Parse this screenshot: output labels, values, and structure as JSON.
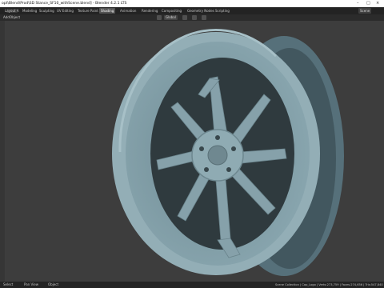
{
  "window": {
    "title": "[C:\\Users\\...\\Desktop\\Wheel Mod\\Blend\\Prod\\SD Stance_SF10_withScene.blend] - Blender 4.2.1 LTS",
    "title_visible": "opt\\Blend\\Prod\\SD Stance_SF10_withScene.blend] - Blender 4.2.1 LTS",
    "min_glyph": "–",
    "max_glyph": "□",
    "close_glyph": "×"
  },
  "menubar": {
    "tabs": [
      "Layout",
      "Modeling",
      "Sculpting",
      "UV Editing",
      "Texture Paint",
      "Shading",
      "Animation",
      "Rendering",
      "Compositing",
      "Geometry Nodes",
      "Scripting"
    ],
    "tabs_visible": [
      "Layout A",
      "Modeling",
      "Sculpting",
      "UV Editing",
      "Texture Paint",
      "Shading",
      "Animation",
      "Rendering",
      "Compositing",
      "Geometry Nodes",
      "Scripting"
    ],
    "active_tab": "Shading",
    "scene_label": "Scene",
    "viewlayer_label": "ViewLayer"
  },
  "header": {
    "left_items": [
      "Add",
      "Object"
    ],
    "transform_orientation": "Global",
    "snap_icon": "magnet-icon",
    "proportional_icon": "circle-icon"
  },
  "statusbar": {
    "left_action": "Select",
    "middle_action": "Pan View",
    "right_action": "Object",
    "stats": "Scene Collection | Cap_Logo | Verts:273,759 | Faces:274,656 | Tris:547,840"
  },
  "viewport": {
    "background": "#3d3d3d",
    "rim_color": "#7f9aa3",
    "rim_shadow": "#5f7880",
    "spoke_count": 10
  }
}
